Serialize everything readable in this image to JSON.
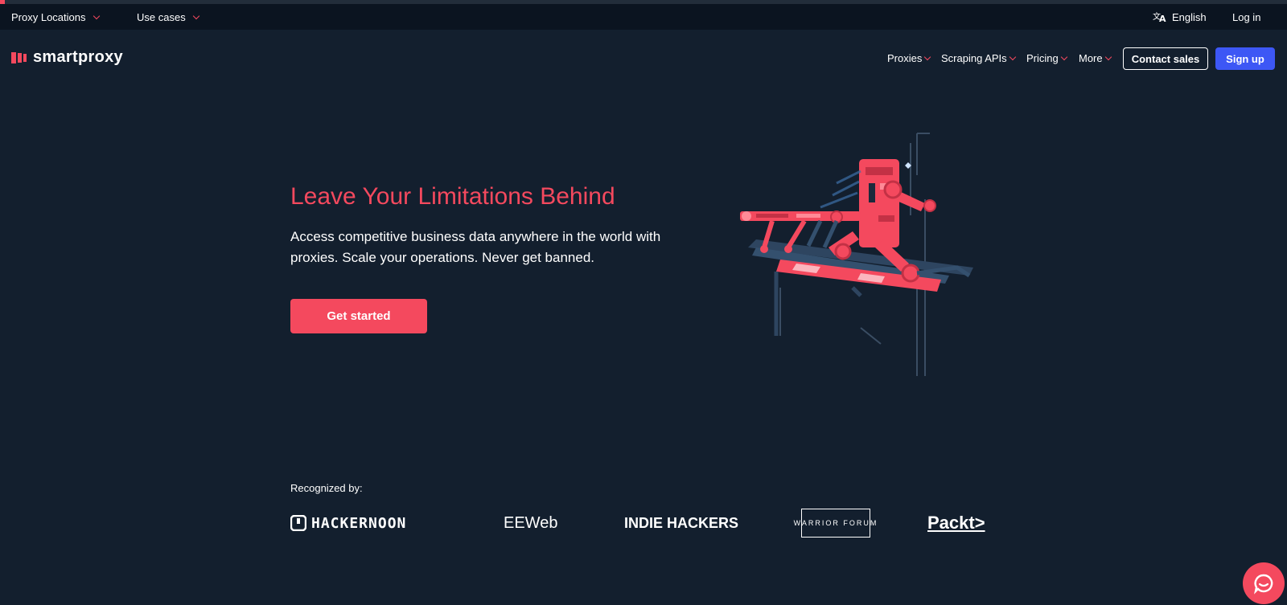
{
  "topbar": {
    "proxy_locations": "Proxy Locations",
    "use_cases": "Use cases",
    "language": "English",
    "login": "Log in"
  },
  "nav": {
    "brand": "smartproxy",
    "links": [
      "Proxies",
      "Scraping APIs",
      "Pricing",
      "More"
    ],
    "contact_sales": "Contact sales",
    "sign_up": "Sign up"
  },
  "hero": {
    "title": "Leave Your Limitations Behind",
    "subtitle": "Access competitive business data anywhere in the world with proxies. Scale your operations. Never get banned.",
    "cta": "Get started"
  },
  "recognized": {
    "label": "Recognized by:",
    "logos": [
      "HACKERNOON",
      "EEWeb",
      "INDIE HACKERS",
      "WARRIOR FORUM",
      "Packt>"
    ]
  },
  "colors": {
    "background": "#131f2e",
    "topbar": "#0b1420",
    "accent": "#f4495e",
    "signup": "#3d57f5"
  },
  "icons": {
    "translate": "translate-icon",
    "chevron": "chevron-down-icon",
    "chat": "chat-icon"
  }
}
